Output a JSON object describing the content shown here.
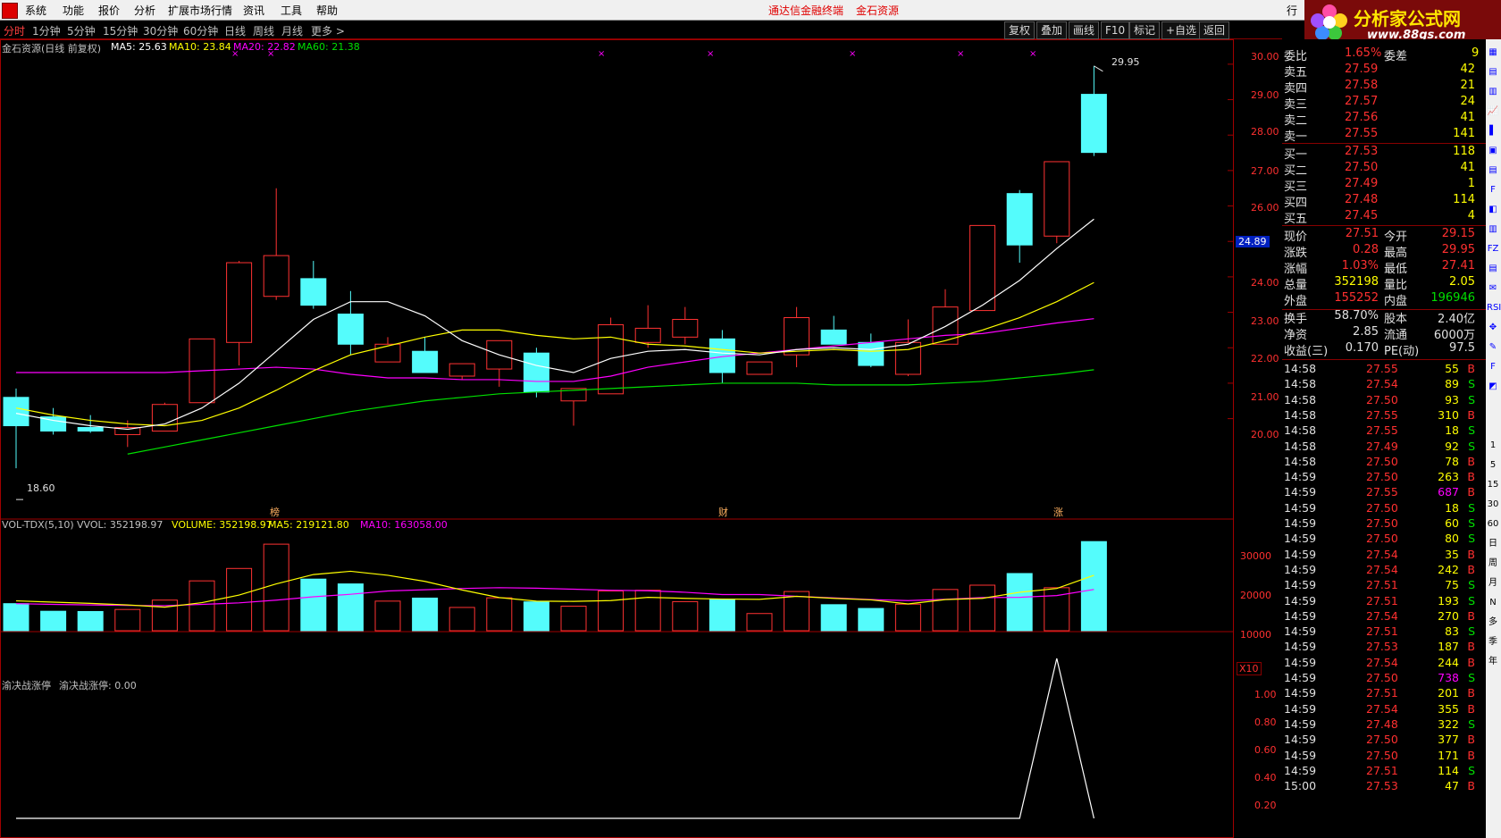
{
  "menubar": {
    "items": [
      "系统",
      "功能",
      "报价",
      "分析",
      "扩展市场行情",
      "资讯",
      "工具",
      "帮助"
    ],
    "center_title": "通达信金融终端",
    "stock_title": "金石资源",
    "right_btn": "行"
  },
  "logo": {
    "title": "分析家公式网",
    "url": "www.88gs.com"
  },
  "tabs": [
    "分时",
    "1分钟",
    "5分钟",
    "15分钟",
    "30分钟",
    "60分钟",
    "日线",
    "周线",
    "月线",
    "更多 >"
  ],
  "toolbar_buttons": [
    "复权",
    "叠加",
    "画线",
    "F10",
    "标记",
    "+自选",
    "返回"
  ],
  "main_chart": {
    "title": "金石资源(日线 前复权)",
    "ma5": "MA5: 25.63",
    "ma10": "MA10: 23.84",
    "ma20": "MA20: 22.82",
    "ma60": "MA60: 21.38",
    "high_label": "29.95",
    "low_label": "18.60",
    "price_tag": "24.89",
    "y_ticks": [
      "30.00",
      "29.00",
      "28.00",
      "27.00",
      "26.00",
      "25.00",
      "24.00",
      "23.00",
      "22.00",
      "21.00",
      "20.00"
    ],
    "markers": [
      "榜",
      "财",
      "涨"
    ],
    "colors": {
      "up": "#ff3232",
      "down": "#54fcfc",
      "ma5": "#ffffff",
      "ma10": "#ffff00",
      "ma20": "#ff00ff",
      "ma60": "#00e000"
    }
  },
  "vol_chart": {
    "title": "VOL-TDX(5,10)",
    "vvol": "VVOL: 352198.97",
    "volume": "VOLUME: 352198.97",
    "ma5": "MA5: 219121.80",
    "ma10": "MA10: 163058.00",
    "y_ticks": [
      "30000",
      "20000",
      "10000"
    ],
    "unit": "X10"
  },
  "ind_chart": {
    "title": "渝决战涨停",
    "value": "渝决战涨停: 0.00",
    "y_ticks": [
      "1.00",
      "0.80",
      "0.60",
      "0.40",
      "0.20"
    ]
  },
  "chart_data": {
    "type": "candlestick",
    "candles": [
      {
        "o": 20.6,
        "h": 20.85,
        "l": 18.6,
        "c": 19.8
      },
      {
        "o": 20.05,
        "h": 20.3,
        "l": 19.55,
        "c": 19.65
      },
      {
        "o": 19.75,
        "h": 20.1,
        "l": 19.6,
        "c": 19.65
      },
      {
        "o": 19.55,
        "h": 19.95,
        "l": 19.2,
        "c": 19.75
      },
      {
        "o": 19.65,
        "h": 20.45,
        "l": 19.65,
        "c": 20.4
      },
      {
        "o": 20.45,
        "h": 22.25,
        "l": 20.45,
        "c": 22.25
      },
      {
        "o": 22.15,
        "h": 24.45,
        "l": 21.5,
        "c": 24.4
      },
      {
        "o": 23.45,
        "h": 26.5,
        "l": 23.35,
        "c": 24.6
      },
      {
        "o": 23.95,
        "h": 24.45,
        "l": 23.1,
        "c": 23.2
      },
      {
        "o": 22.95,
        "h": 23.6,
        "l": 21.8,
        "c": 22.1
      },
      {
        "o": 21.6,
        "h": 22.3,
        "l": 21.6,
        "c": 22.1
      },
      {
        "o": 21.9,
        "h": 22.3,
        "l": 21.3,
        "c": 21.3
      },
      {
        "o": 21.2,
        "h": 21.55,
        "l": 21.1,
        "c": 21.55
      },
      {
        "o": 21.4,
        "h": 22.2,
        "l": 20.9,
        "c": 22.2
      },
      {
        "o": 21.85,
        "h": 22.0,
        "l": 20.6,
        "c": 20.75
      },
      {
        "o": 20.5,
        "h": 20.85,
        "l": 19.8,
        "c": 20.85
      },
      {
        "o": 20.7,
        "h": 22.85,
        "l": 20.7,
        "c": 22.65
      },
      {
        "o": 22.15,
        "h": 23.2,
        "l": 22.0,
        "c": 22.55
      },
      {
        "o": 22.3,
        "h": 23.15,
        "l": 22.1,
        "c": 22.8
      },
      {
        "o": 22.25,
        "h": 22.5,
        "l": 21.0,
        "c": 21.3
      },
      {
        "o": 21.25,
        "h": 21.6,
        "l": 21.25,
        "c": 21.6
      },
      {
        "o": 21.8,
        "h": 23.15,
        "l": 21.45,
        "c": 22.85
      },
      {
        "o": 22.5,
        "h": 22.9,
        "l": 22.15,
        "c": 22.1
      },
      {
        "o": 22.15,
        "h": 22.4,
        "l": 21.45,
        "c": 21.5
      },
      {
        "o": 21.25,
        "h": 22.8,
        "l": 21.2,
        "c": 22.15
      },
      {
        "o": 22.1,
        "h": 23.65,
        "l": 22.1,
        "c": 23.15
      },
      {
        "o": 23.05,
        "h": 25.45,
        "l": 23.05,
        "c": 25.45
      },
      {
        "o": 26.35,
        "h": 26.45,
        "l": 24.4,
        "c": 24.9
      },
      {
        "o": 25.15,
        "h": 27.25,
        "l": 24.95,
        "c": 27.25
      },
      {
        "o": 29.15,
        "h": 29.95,
        "l": 27.41,
        "c": 27.51
      }
    ],
    "ma5": [
      20.15,
      19.95,
      19.8,
      19.7,
      19.85,
      20.3,
      21.0,
      21.9,
      22.8,
      23.3,
      23.3,
      22.9,
      22.2,
      21.8,
      21.5,
      21.3,
      21.7,
      21.9,
      21.95,
      21.85,
      21.8,
      21.95,
      22.0,
      21.95,
      22.1,
      22.6,
      23.2,
      23.9,
      24.8,
      25.63
    ],
    "ma10": [
      20.3,
      20.1,
      19.95,
      19.85,
      19.8,
      19.95,
      20.3,
      20.8,
      21.35,
      21.8,
      22.05,
      22.3,
      22.5,
      22.5,
      22.35,
      22.25,
      22.3,
      22.1,
      22.05,
      21.95,
      21.85,
      21.9,
      21.95,
      21.9,
      21.95,
      22.2,
      22.5,
      22.85,
      23.3,
      23.84
    ],
    "ma20": [
      21.3,
      21.3,
      21.3,
      21.3,
      21.3,
      21.35,
      21.4,
      21.45,
      21.4,
      21.25,
      21.15,
      21.15,
      21.1,
      21.1,
      21.05,
      21.05,
      21.2,
      21.45,
      21.6,
      21.75,
      21.85,
      21.95,
      22.05,
      22.15,
      22.25,
      22.35,
      22.4,
      22.55,
      22.7,
      22.82
    ],
    "ma60": [
      null,
      null,
      null,
      19.0,
      19.2,
      19.4,
      19.6,
      19.8,
      20.0,
      20.2,
      20.35,
      20.5,
      20.6,
      20.7,
      20.75,
      20.8,
      20.85,
      20.9,
      20.95,
      21.0,
      21.0,
      21.0,
      20.95,
      20.95,
      20.95,
      21.0,
      21.05,
      21.15,
      21.25,
      21.38
    ],
    "volume": [
      107000,
      77000,
      76000,
      84000,
      121000,
      197000,
      246000,
      342000,
      204000,
      185000,
      117000,
      129000,
      92000,
      130000,
      114000,
      97000,
      157000,
      160000,
      115000,
      124000,
      68000,
      155000,
      103000,
      88000,
      105000,
      163000,
      180000,
      226000,
      170000,
      352199
    ],
    "vol_ma5": [
      118000,
      113000,
      108000,
      102000,
      93000,
      111000,
      141000,
      185000,
      222000,
      235000,
      219000,
      195000,
      161000,
      131000,
      117000,
      116000,
      119000,
      132000,
      128000,
      125000,
      124000,
      136000,
      128000,
      122000,
      106000,
      123000,
      128000,
      152000,
      167000,
      219122
    ],
    "vol_ma10": [
      107000,
      104000,
      102000,
      100000,
      99000,
      104000,
      110000,
      121000,
      134000,
      144000,
      157000,
      162000,
      167000,
      170000,
      168000,
      164000,
      160000,
      158000,
      152000,
      143000,
      143000,
      136000,
      130000,
      123000,
      119000,
      124000,
      131000,
      132000,
      139000,
      163058
    ],
    "indicator": [
      0,
      0,
      0,
      0,
      0,
      0,
      0,
      0,
      0,
      0,
      0,
      0,
      0,
      0,
      0,
      0,
      0,
      0,
      0,
      0,
      0,
      0,
      0,
      0,
      0,
      0,
      0,
      0,
      1,
      0
    ],
    "price_range": [
      18.2,
      30.4
    ],
    "vol_range": [
      0,
      360000
    ],
    "ind_range": [
      0,
      1.05
    ]
  },
  "orderbook": {
    "weibi": {
      "label": "委比",
      "value": "1.65%",
      "label2": "委差",
      "value2": "9"
    },
    "asks": [
      {
        "label": "卖五",
        "price": "27.59",
        "vol": "42"
      },
      {
        "label": "卖四",
        "price": "27.58",
        "vol": "21"
      },
      {
        "label": "卖三",
        "price": "27.57",
        "vol": "24"
      },
      {
        "label": "卖二",
        "price": "27.56",
        "vol": "41"
      },
      {
        "label": "卖一",
        "price": "27.55",
        "vol": "141"
      }
    ],
    "bids": [
      {
        "label": "买一",
        "price": "27.53",
        "vol": "118"
      },
      {
        "label": "买二",
        "price": "27.50",
        "vol": "41"
      },
      {
        "label": "买三",
        "price": "27.49",
        "vol": "1"
      },
      {
        "label": "买四",
        "price": "27.48",
        "vol": "114"
      },
      {
        "label": "买五",
        "price": "27.45",
        "vol": "4"
      }
    ]
  },
  "quote": [
    {
      "l1": "现价",
      "v1": "27.51",
      "l2": "今开",
      "v2": "29.15",
      "c1": "#ff3030",
      "c2": "#ff3030"
    },
    {
      "l1": "涨跌",
      "v1": "0.28",
      "l2": "最高",
      "v2": "29.95",
      "c1": "#ff3030",
      "c2": "#ff3030"
    },
    {
      "l1": "涨幅",
      "v1": "1.03%",
      "l2": "最低",
      "v2": "27.41",
      "c1": "#ff3030",
      "c2": "#ff3030"
    },
    {
      "l1": "总量",
      "v1": "352198",
      "l2": "量比",
      "v2": "2.05",
      "c1": "#ffff00",
      "c2": "#ffff00"
    },
    {
      "l1": "外盘",
      "v1": "155252",
      "l2": "内盘",
      "v2": "196946",
      "c1": "#ff3030",
      "c2": "#00e000"
    },
    {
      "l1": "换手",
      "v1": "58.70%",
      "l2": "股本",
      "v2": "2.40亿",
      "c1": "#e0e0e0",
      "c2": "#e0e0e0"
    },
    {
      "l1": "净资",
      "v1": "2.85",
      "l2": "流通",
      "v2": "6000万",
      "c1": "#e0e0e0",
      "c2": "#e0e0e0"
    },
    {
      "l1": "收益(三)",
      "v1": "0.170",
      "l2": "PE(动)",
      "v2": "97.5",
      "c1": "#e0e0e0",
      "c2": "#e0e0e0"
    }
  ],
  "ticks": [
    {
      "t": "14:58",
      "p": "27.55",
      "v": "55",
      "d": "B"
    },
    {
      "t": "14:58",
      "p": "27.54",
      "v": "89",
      "d": "S"
    },
    {
      "t": "14:58",
      "p": "27.50",
      "v": "93",
      "d": "S"
    },
    {
      "t": "14:58",
      "p": "27.55",
      "v": "310",
      "d": "B"
    },
    {
      "t": "14:58",
      "p": "27.55",
      "v": "18",
      "d": "S"
    },
    {
      "t": "14:58",
      "p": "27.49",
      "v": "92",
      "d": "S"
    },
    {
      "t": "14:58",
      "p": "27.50",
      "v": "78",
      "d": "B"
    },
    {
      "t": "14:59",
      "p": "27.50",
      "v": "263",
      "d": "B"
    },
    {
      "t": "14:59",
      "p": "27.55",
      "v": "687",
      "d": "B"
    },
    {
      "t": "14:59",
      "p": "27.50",
      "v": "18",
      "d": "S"
    },
    {
      "t": "14:59",
      "p": "27.50",
      "v": "60",
      "d": "S"
    },
    {
      "t": "14:59",
      "p": "27.50",
      "v": "80",
      "d": "S"
    },
    {
      "t": "14:59",
      "p": "27.54",
      "v": "35",
      "d": "B"
    },
    {
      "t": "14:59",
      "p": "27.54",
      "v": "242",
      "d": "B"
    },
    {
      "t": "14:59",
      "p": "27.51",
      "v": "75",
      "d": "S"
    },
    {
      "t": "14:59",
      "p": "27.51",
      "v": "193",
      "d": "S"
    },
    {
      "t": "14:59",
      "p": "27.54",
      "v": "270",
      "d": "B"
    },
    {
      "t": "14:59",
      "p": "27.51",
      "v": "83",
      "d": "S"
    },
    {
      "t": "14:59",
      "p": "27.53",
      "v": "187",
      "d": "B"
    },
    {
      "t": "14:59",
      "p": "27.54",
      "v": "244",
      "d": "B"
    },
    {
      "t": "14:59",
      "p": "27.50",
      "v": "738",
      "d": "S"
    },
    {
      "t": "14:59",
      "p": "27.51",
      "v": "201",
      "d": "B"
    },
    {
      "t": "14:59",
      "p": "27.54",
      "v": "355",
      "d": "B"
    },
    {
      "t": "14:59",
      "p": "27.48",
      "v": "322",
      "d": "S"
    },
    {
      "t": "14:59",
      "p": "27.50",
      "v": "377",
      "d": "B"
    },
    {
      "t": "14:59",
      "p": "27.50",
      "v": "171",
      "d": "B"
    },
    {
      "t": "14:59",
      "p": "27.51",
      "v": "114",
      "d": "S"
    },
    {
      "t": "15:00",
      "p": "27.53",
      "v": "47",
      "d": "B"
    }
  ],
  "side_toolbar": [
    "1",
    "5",
    "15",
    "30",
    "60",
    "日",
    "周",
    "月",
    "N",
    "多",
    "季",
    "年"
  ]
}
